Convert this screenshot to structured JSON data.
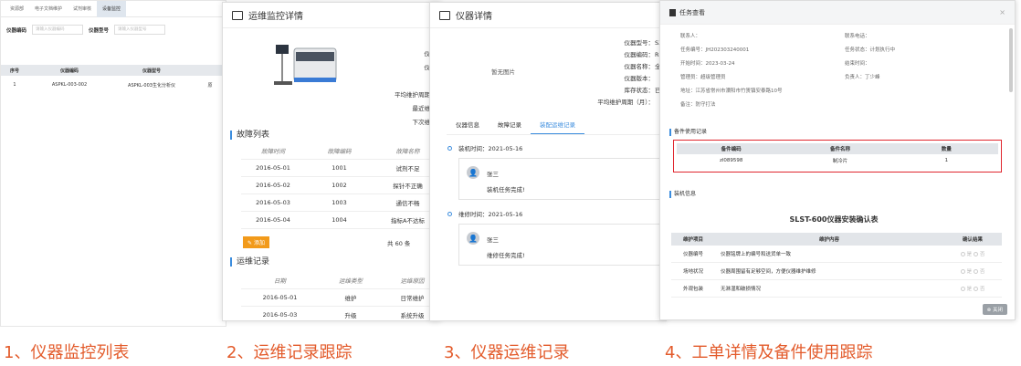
{
  "panel1": {
    "tabs": [
      "资源部",
      "电子文档维护",
      "试剂审核",
      "设备监控"
    ],
    "filter_labels": [
      "仪器编码",
      "仪器型号"
    ],
    "filter_placeholders": [
      "请输入仪器编码",
      "请输入仪器型号"
    ],
    "columns": [
      "序号",
      "仪器编码",
      "仪器型号"
    ],
    "rows": [
      [
        "1",
        "ASPKL-003-002",
        "ASPKL-003生化分析仪",
        "原"
      ]
    ]
  },
  "panel2": {
    "title": "运维监控详情",
    "fields": [
      "I",
      "仪器型",
      "仪器编",
      "名",
      "平均维护周期（月",
      "最近维护日",
      "下次维护日"
    ],
    "fault_title": "故障列表",
    "fault_columns": [
      "故障时间",
      "故障编码",
      "故障名称"
    ],
    "fault_rows": [
      [
        "2016-05-01",
        "1001",
        "试剂不足"
      ],
      [
        "2016-05-02",
        "1002",
        "探针不正确"
      ],
      [
        "2016-05-03",
        "1003",
        "通信不畅"
      ],
      [
        "2016-05-04",
        "1004",
        "指标A不达标"
      ]
    ],
    "add_label": "添加",
    "total_label": "共 60 条",
    "maint_title": "运维记录",
    "maint_columns": [
      "日期",
      "运维类型",
      "运维原因"
    ],
    "maint_rows": [
      [
        "2016-05-01",
        "维护",
        "日常维护"
      ],
      [
        "2016-05-03",
        "升级",
        "系统升级"
      ]
    ]
  },
  "panel3": {
    "title": "仪器详情",
    "no_image": "暂无图片",
    "fields": [
      "仪器型号：",
      "仪器编码：",
      "仪器名称：",
      "仪器版本：",
      "库存状态：",
      "平均维护周期（月）："
    ],
    "field_values": [
      "SX",
      "RK",
      "全自",
      "",
      "已出",
      ""
    ],
    "tabs": [
      "仪器信息",
      "故障记录",
      "装配运维记录"
    ],
    "records": [
      {
        "time": "装机时间：2021-05-16",
        "user": "张三",
        "text": "装机任务完成!"
      },
      {
        "time": "维修时间：2021-05-16",
        "user": "张三",
        "text": "维修任务完成!"
      }
    ]
  },
  "panel4": {
    "title": "任务查看",
    "info": [
      {
        "label": "联系人：",
        "value": ""
      },
      {
        "label": "联系电话：",
        "value": ""
      },
      {
        "label": "任务编号：",
        "value": "JH202303240001"
      },
      {
        "label": "任务状态：",
        "value": "计划执行中"
      },
      {
        "label": "开始时间：",
        "value": "2023-03-24"
      },
      {
        "label": "结束时间：",
        "value": ""
      },
      {
        "label": "管理员：",
        "value": "超级管理员"
      },
      {
        "label": "负责人：",
        "value": "丁少峰"
      },
      {
        "label": "地址：",
        "value": "江苏省常州市溧阳市竹箦镇安泰路10号"
      },
      {
        "label": "备注：",
        "value": "防守打法"
      }
    ],
    "parts_title": "备件使用记录",
    "parts_columns": [
      "备件编码",
      "备件名称",
      "数量"
    ],
    "parts_rows": [
      [
        "zl089598",
        "制冷片",
        "1"
      ]
    ],
    "install_title": "装机信息",
    "confirm_title": "SLST-600仪器安装确认表",
    "confirm_columns": [
      "维护项目",
      "维护内容",
      "确认结果"
    ],
    "confirm_rows": [
      [
        "仪器编号",
        "仪器铭牌上的编号和送货单一致"
      ],
      [
        "场地状况",
        "仪器周围留有足够空间，方便仪器维护维修"
      ],
      [
        "外观包装",
        "无淋湿和破损情况"
      ]
    ],
    "radio_labels": [
      "是",
      "否"
    ],
    "close_label": "关闭",
    "highlight_color": "#e0262e"
  },
  "captions": [
    "1、仪器监控列表",
    "2、运维记录跟踪",
    "3、仪器运维记录",
    "4、工单详情及备件使用跟踪"
  ]
}
